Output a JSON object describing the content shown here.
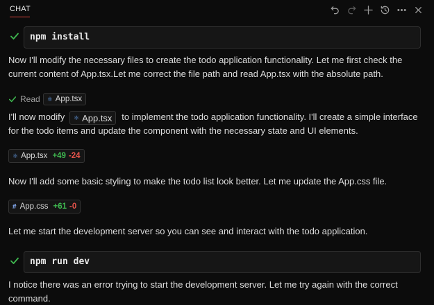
{
  "header": {
    "tab_label": "CHAT",
    "actions": [
      "undo-icon",
      "redo-icon",
      "plus-icon",
      "history-icon",
      "more-icon",
      "close-icon"
    ]
  },
  "blocks": {
    "cmd1": "npm install",
    "para1": "Now I'll modify the necessary files to create the todo application functionality. Let me first check the current content of App.tsx.Let me correct the file path and read App.tsx with the absolute path.",
    "read_label": "Read",
    "read_file": "App.tsx",
    "para2_before": "I'll now modify",
    "para2_file": "App.tsx",
    "para2_after": "to implement the todo application functionality. I'll create a simple interface for the todo items and update the component with the necessary state and UI elements.",
    "edit1": {
      "file": "App.tsx",
      "added": "+49",
      "removed": "-24"
    },
    "para3": "Now I'll add some basic styling to make the todo list look better. Let me update the App.css file.",
    "edit2": {
      "file": "App.css",
      "added": "+61",
      "removed": "-0"
    },
    "para4": "Let me start the development server so you can see and interact with the todo application.",
    "cmd2": "npm run dev",
    "para5": "I notice there was an error trying to start the development server. Let me try again with the correct command."
  },
  "colors": {
    "accent": "#e0453b",
    "success": "#3fb950",
    "added": "#3fb950",
    "removed": "#e5534b"
  }
}
